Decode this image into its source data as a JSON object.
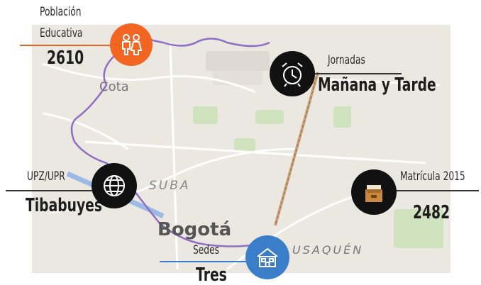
{
  "map": {
    "places": {
      "cota": "Cota",
      "suba": "SUBA",
      "bogota": "Bogotá",
      "usaquen": "USAQUÉN"
    },
    "colors": {
      "land": "#ebe7e1",
      "green": "#cfe3bf",
      "boundary": "#8e6fc4",
      "river": "#9db9e6",
      "railway": "#c9a27a"
    }
  },
  "callouts": {
    "poblacion": {
      "label_line1": "Población",
      "label_line2": "Educativa",
      "value": "2610",
      "icon": "people-icon",
      "color": "#f26522"
    },
    "jornadas": {
      "label": "Jornadas",
      "value": "Mañana y Tarde",
      "icon": "alarm-clock-icon",
      "color": "#111111"
    },
    "upz": {
      "label": "UPZ/UPR",
      "value": "Tibabuyes",
      "icon": "globe-icon",
      "color": "#111111"
    },
    "matricula": {
      "label": "Matrícula 2015",
      "value": "2482",
      "icon": "file-box-icon",
      "color": "#111111"
    },
    "sedes": {
      "label": "Sedes",
      "value": "Tres",
      "icon": "building-icon",
      "color": "#3a7dc9"
    }
  }
}
